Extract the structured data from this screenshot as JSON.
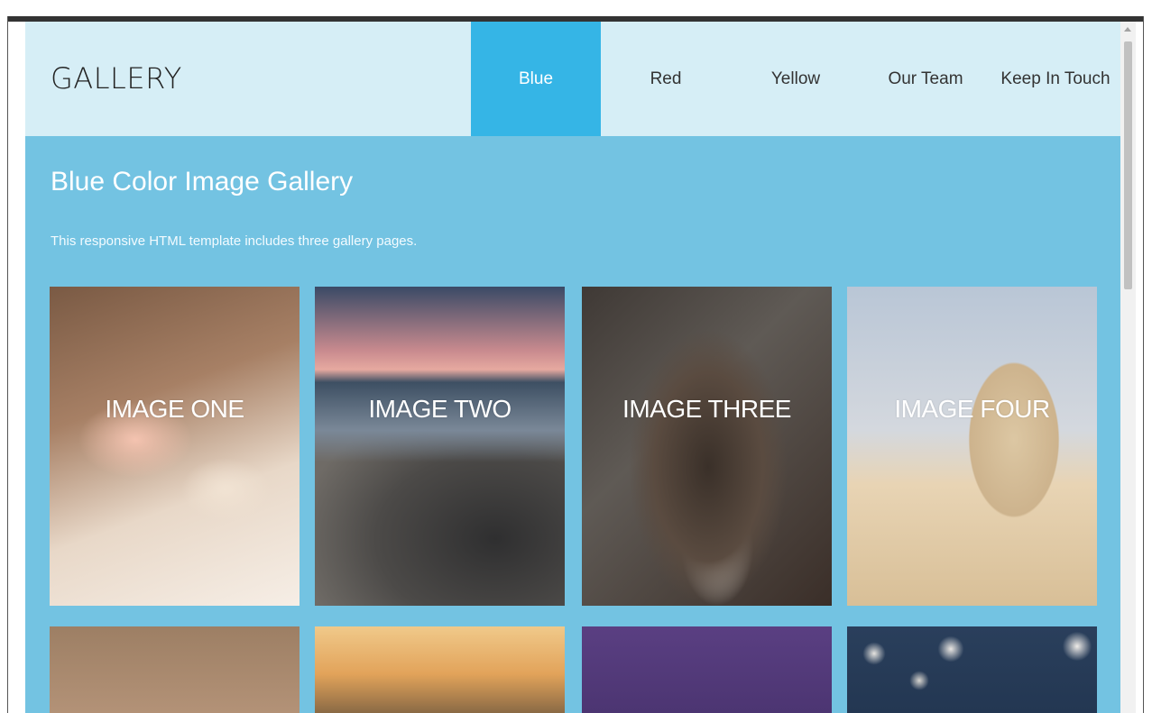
{
  "header": {
    "brand": "GALLERY",
    "nav": [
      {
        "label": "Blue",
        "active": true
      },
      {
        "label": "Red",
        "active": false
      },
      {
        "label": "Yellow",
        "active": false
      },
      {
        "label": "Our Team",
        "active": false
      },
      {
        "label": "Keep In Touch",
        "active": false
      }
    ]
  },
  "main": {
    "title": "Blue Color Image Gallery",
    "description": "This responsive HTML template includes three gallery pages.",
    "tiles": [
      {
        "caption": "IMAGE ONE"
      },
      {
        "caption": "IMAGE TWO"
      },
      {
        "caption": "IMAGE THREE"
      },
      {
        "caption": "IMAGE FOUR"
      }
    ]
  },
  "colors": {
    "header_bg": "#d6eef6",
    "nav_active": "#35b5e6",
    "content_bg": "#73c3e2"
  }
}
